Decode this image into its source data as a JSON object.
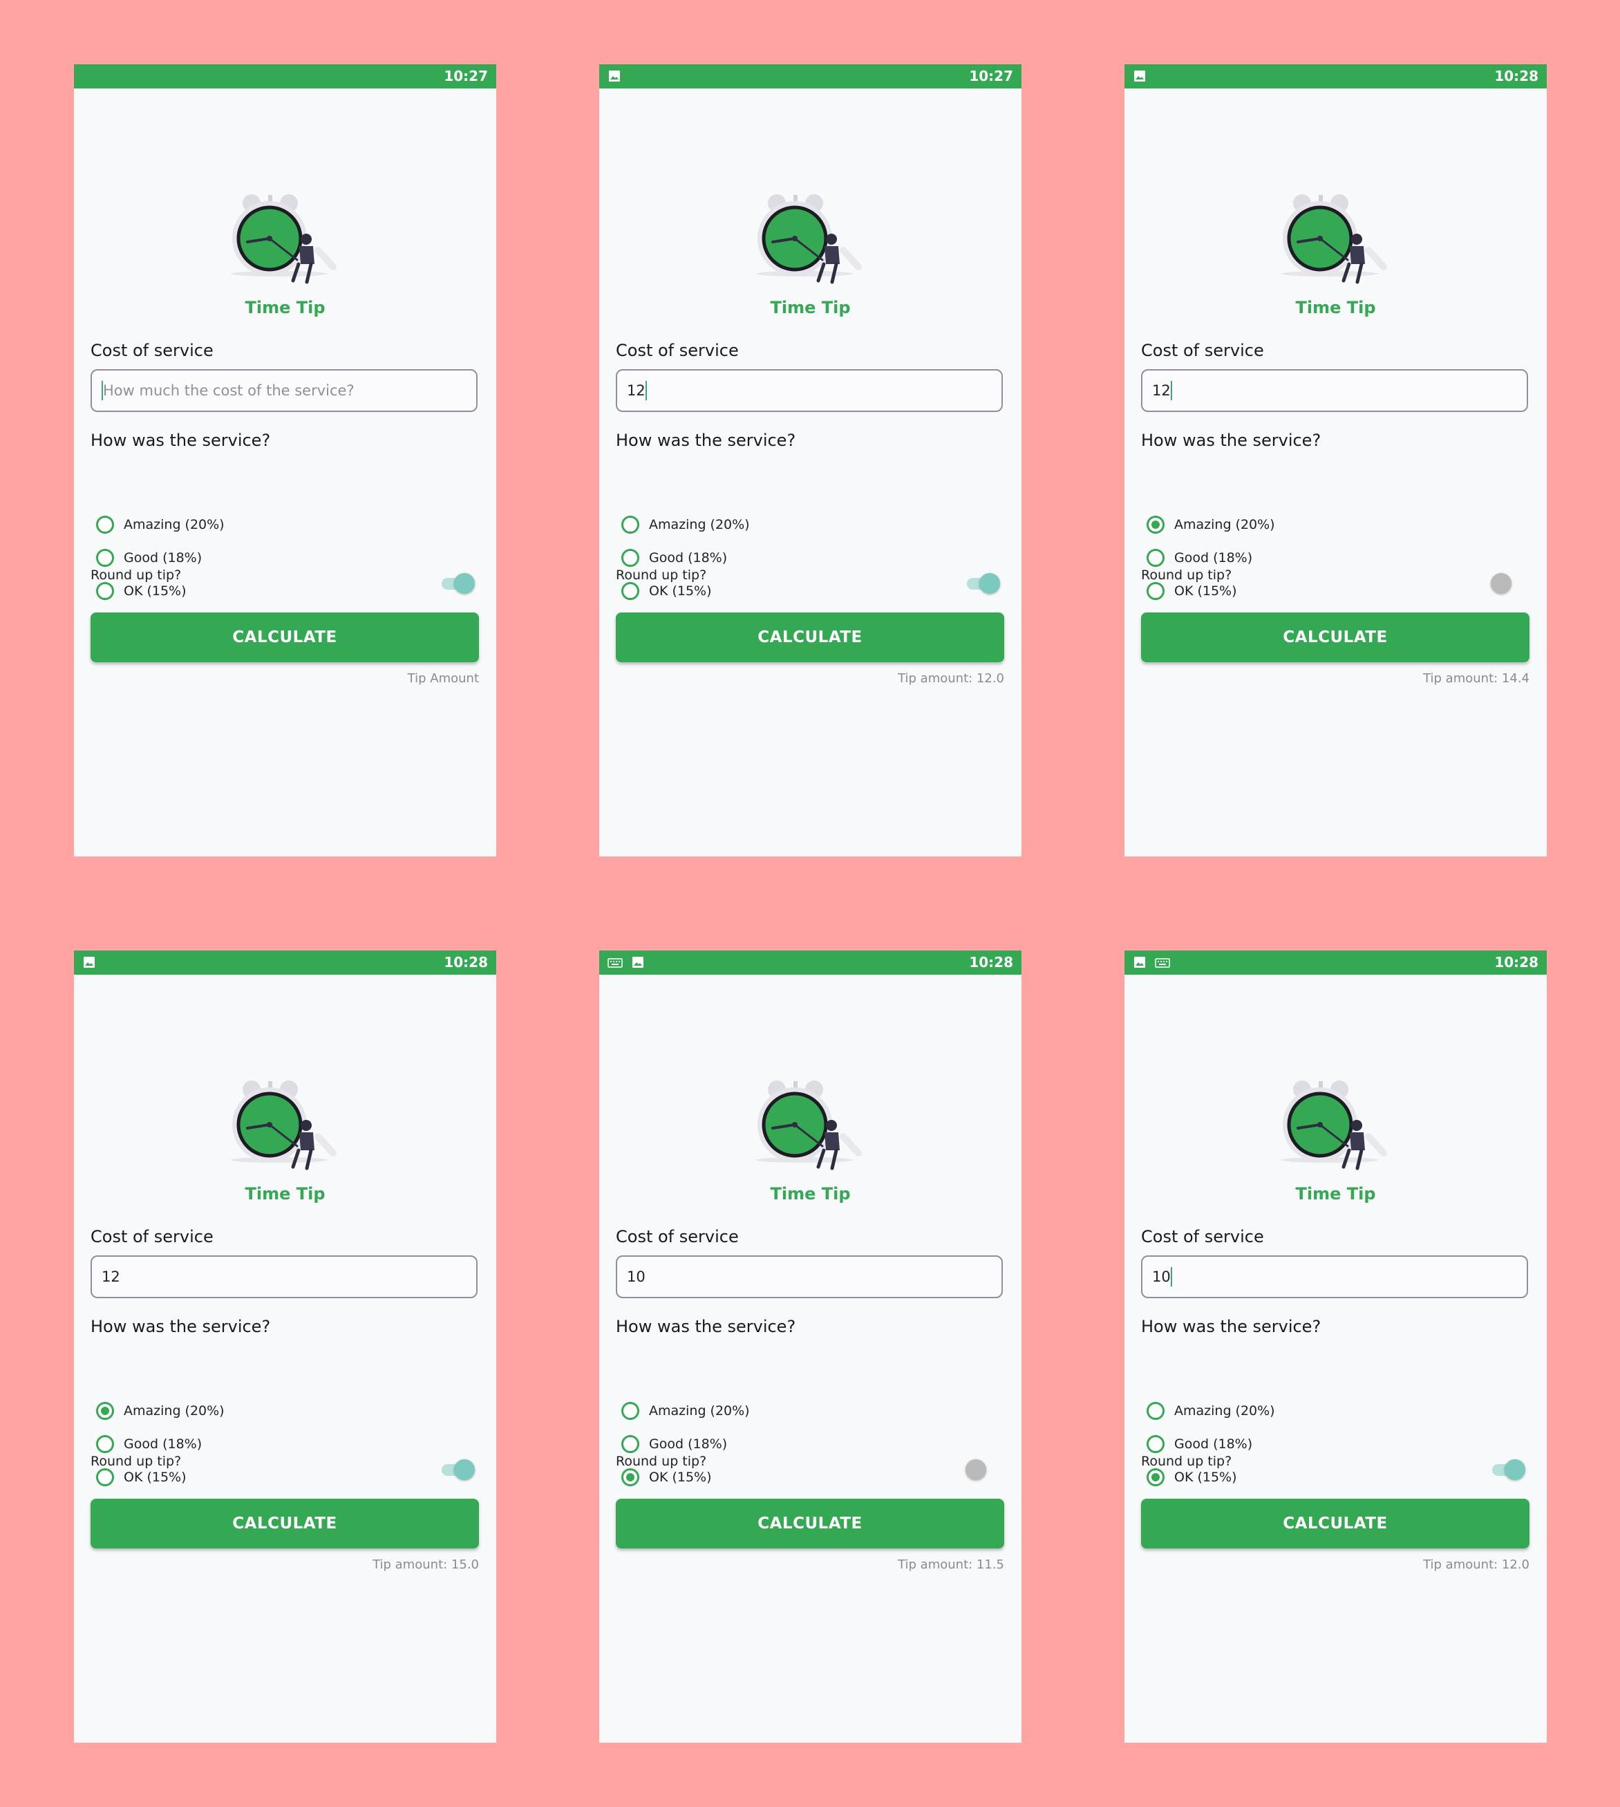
{
  "colors": {
    "background": "#ffa4a3",
    "accent": "#34a853",
    "switch_on": "#7cc9bf",
    "switch_off": "#b9b9b9"
  },
  "app": {
    "title": "Time Tip",
    "cost_label": "Cost of service",
    "placeholder": "How much the cost of the service?",
    "question": "How was the service?",
    "options": [
      "Amazing (20%)",
      "Good (18%)",
      "OK (15%)"
    ],
    "round_label": "Round up tip?",
    "calculate_label": "CALCULATE"
  },
  "screens": [
    {
      "time": "10:27",
      "status_icons": [],
      "input_value": "",
      "show_caret": true,
      "selected_option": -1,
      "round_up": true,
      "tip_text": "Tip Amount"
    },
    {
      "time": "10:27",
      "status_icons": [
        "image-icon"
      ],
      "input_value": "12",
      "show_caret": true,
      "selected_option": -1,
      "round_up": true,
      "tip_text": "Tip amount: 12.0"
    },
    {
      "time": "10:28",
      "status_icons": [
        "image-icon"
      ],
      "input_value": "12",
      "show_caret": true,
      "selected_option": 0,
      "round_up": false,
      "tip_text": "Tip amount: 14.4"
    },
    {
      "time": "10:28",
      "status_icons": [
        "image-icon"
      ],
      "input_value": "12",
      "show_caret": false,
      "selected_option": 0,
      "round_up": true,
      "tip_text": "Tip amount: 15.0"
    },
    {
      "time": "10:28",
      "status_icons": [
        "keyboard-icon",
        "image-icon"
      ],
      "input_value": "10",
      "show_caret": false,
      "selected_option": 2,
      "round_up": false,
      "tip_text": "Tip amount: 11.5"
    },
    {
      "time": "10:28",
      "status_icons": [
        "image-icon",
        "keyboard-icon"
      ],
      "input_value": "10",
      "show_caret": true,
      "selected_option": 2,
      "round_up": true,
      "tip_text": "Tip amount: 12.0"
    }
  ]
}
